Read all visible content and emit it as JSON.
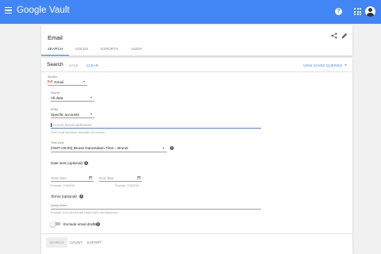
{
  "topbar": {
    "app_title": "Google Vault",
    "help_icon": "help-icon",
    "help_glyph": "?",
    "apps_icon": "apps-grid-icon",
    "menu_icon": "hamburger-menu-icon",
    "accent_color": "#4285f4"
  },
  "matter": {
    "title": "Email",
    "tabs": [
      {
        "label": "SEARCH",
        "active": true
      },
      {
        "label": "HOLDS",
        "active": false
      },
      {
        "label": "EXPORTS",
        "active": false
      },
      {
        "label": "AUDIT",
        "active": false
      }
    ]
  },
  "search": {
    "title": "Search",
    "save_label": "SAVE",
    "clear_label": "CLEAR",
    "view_saved_label": "VIEW SAVED QUERIES",
    "service": {
      "label": "Service",
      "value": "Gmail",
      "icon": "gmail-icon"
    },
    "source": {
      "label": "Source",
      "value": "All data"
    },
    "entity": {
      "label": "Entity",
      "value": "Specific accounts"
    },
    "accounts": {
      "placeholder": "Account email addresses",
      "hint": "Enter email addresses separated by commas"
    },
    "timezone": {
      "label": "Time zone",
      "value": "(GMT+08:00) Brunei Darussalam Time – Brunei"
    },
    "date_sent": {
      "label": "Date sent (optional)",
      "start_placeholder": "Start date",
      "start_hint": "Example: 21/6/2020",
      "end_placeholder": "End date",
      "end_hint": "Example: 22/6/2020"
    },
    "terms": {
      "label": "Terms (optional)",
      "field_label": "Query terms",
      "hint": "Example: from:user@email subject:hello has:attachment"
    },
    "exclude_drafts": {
      "label": "Exclude email drafts",
      "enabled": false
    }
  },
  "footer": {
    "search_label": "SEARCH",
    "count_label": "COUNT",
    "export_label": "EXPORT"
  },
  "info_glyph": "i"
}
